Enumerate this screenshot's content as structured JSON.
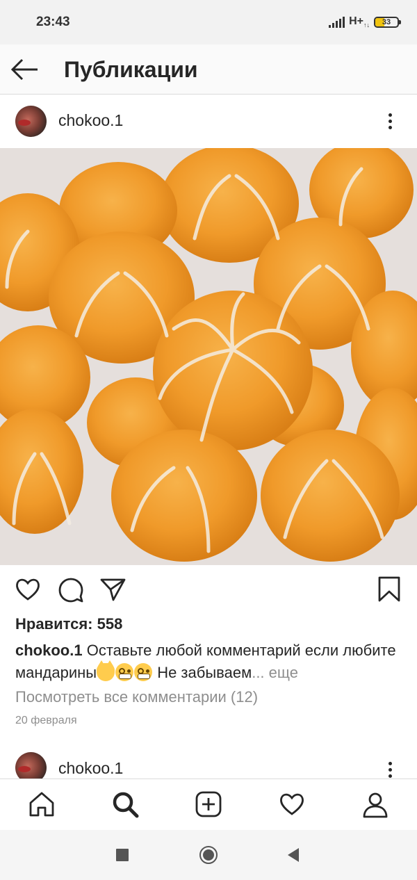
{
  "status_bar": {
    "time": "23:43",
    "network": "H+",
    "network_sub": "↑↓",
    "battery": "33"
  },
  "header": {
    "title": "Публикации",
    "back_icon": "arrow-left-icon"
  },
  "post": {
    "username": "chokoo.1",
    "more_icon": "more-vertical-icon",
    "image_alt": "mandarins photo",
    "actions": {
      "like_icon": "heart-icon",
      "comment_icon": "comment-icon",
      "share_icon": "send-icon",
      "save_icon": "bookmark-icon"
    },
    "likes_text": "Нравится: 558",
    "caption_user": "chokoo.1",
    "caption_text_1": "Оставьте любой комментарий если любите мандарины",
    "caption_text_2": " Не забываем",
    "caption_more": "... еще",
    "view_comments": "Посмотреть все комментарии (12)",
    "date": "20 февраля"
  },
  "next_post": {
    "username": "chokoo.1"
  },
  "bottom_nav": {
    "items": [
      "home-icon",
      "search-icon",
      "add-post-icon",
      "activity-heart-icon",
      "profile-icon"
    ],
    "active": "search-icon"
  },
  "system_nav": {
    "items": [
      "recent-apps-icon",
      "home-circle-icon",
      "back-triangle-icon"
    ]
  }
}
